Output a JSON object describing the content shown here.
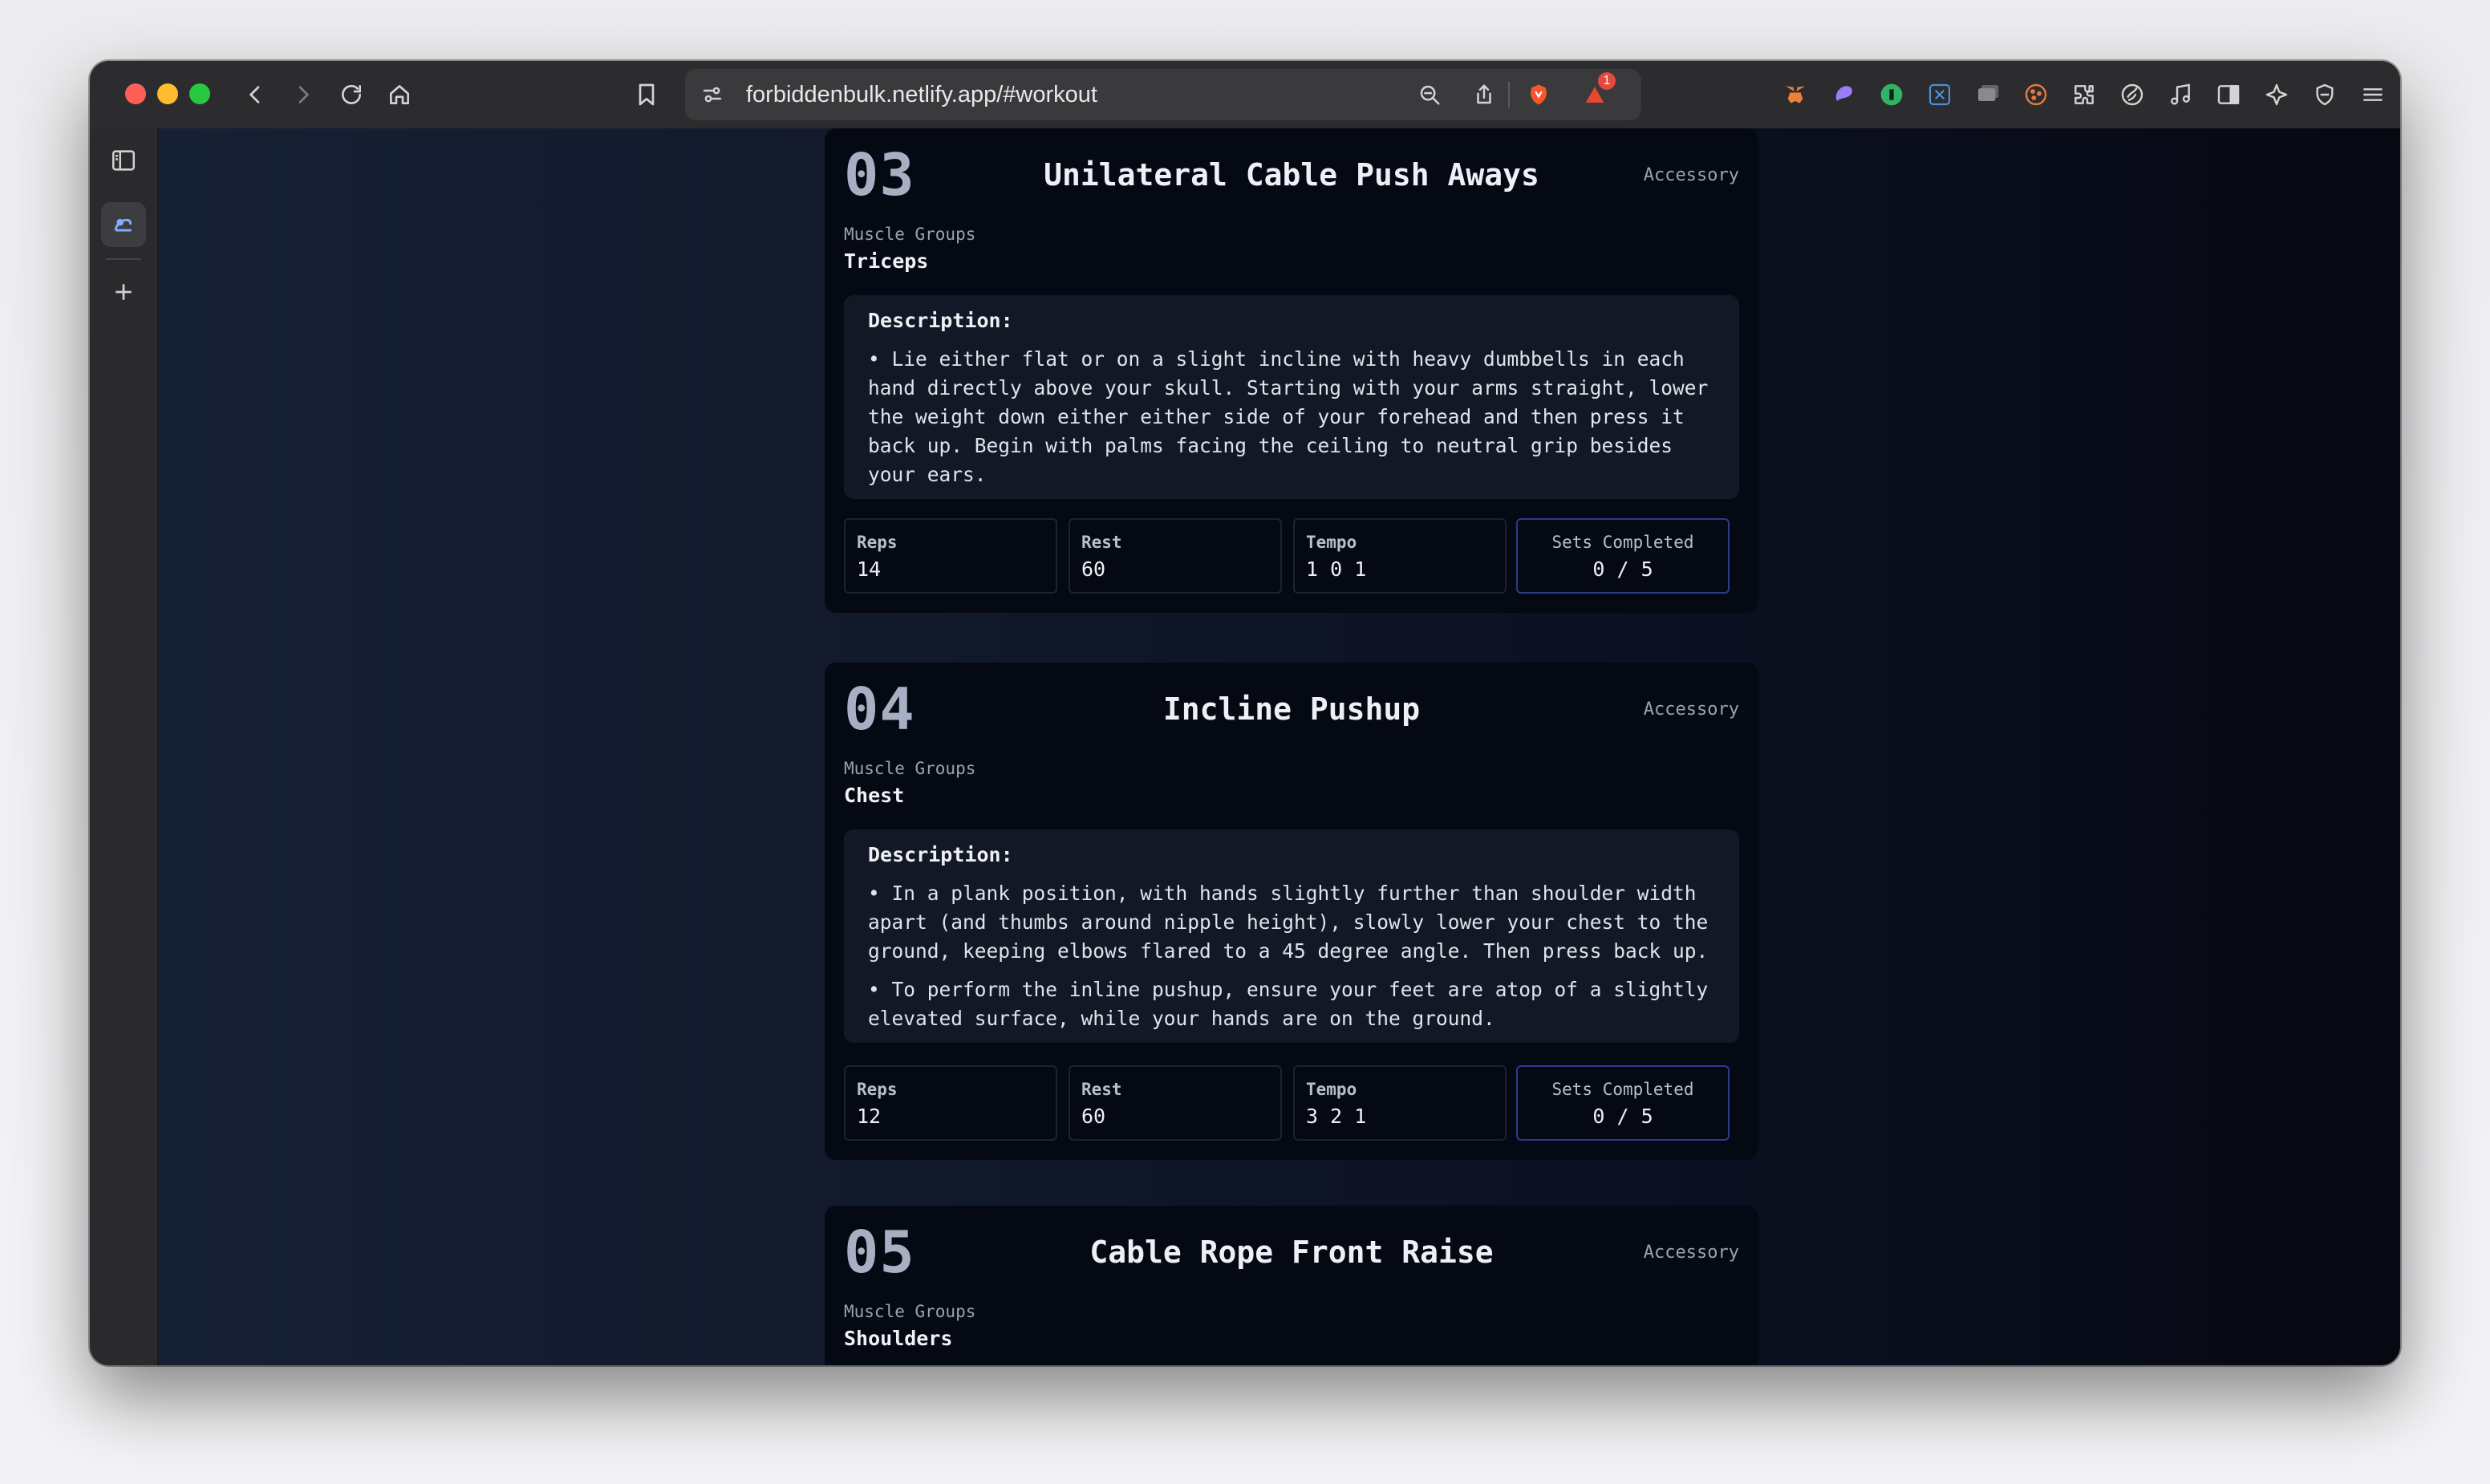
{
  "browser": {
    "url": "forbiddenbulk.netlify.app/#workout",
    "notification_count": "1"
  },
  "exercises": [
    {
      "number": "03",
      "title": "Unilateral Cable Push Aways",
      "category": "Accessory",
      "muscle_label": "Muscle Groups",
      "muscle_value": "Triceps",
      "desc_heading": "Description:",
      "bullets": [
        "• Lie either flat or on a slight incline with heavy dumbbells in each hand directly above your skull. Starting with your arms straight, lower the weight down either either side of your forehead and then press it back up. Begin with palms facing the ceiling to neutral grip besides your ears."
      ],
      "stats": {
        "reps_label": "Reps",
        "reps": "14",
        "rest_label": "Rest",
        "rest": "60",
        "tempo_label": "Tempo",
        "tempo": "1 0 1",
        "sets_label": "Sets Completed",
        "sets": "0 / 5"
      }
    },
    {
      "number": "04",
      "title": "Incline Pushup",
      "category": "Accessory",
      "muscle_label": "Muscle Groups",
      "muscle_value": "Chest",
      "desc_heading": "Description:",
      "bullets": [
        "• In a plank position, with hands slightly further than shoulder width apart (and thumbs around nipple height), slowly lower your chest to the ground, keeping elbows flared to a 45 degree angle. Then press back up.",
        "• To perform the inline pushup, ensure your feet are atop of a slightly elevated surface, while your hands are on the ground."
      ],
      "stats": {
        "reps_label": "Reps",
        "reps": "12",
        "rest_label": "Rest",
        "rest": "60",
        "tempo_label": "Tempo",
        "tempo": "3 2 1",
        "sets_label": "Sets Completed",
        "sets": "0 / 5"
      }
    },
    {
      "number": "05",
      "title": "Cable Rope Front Raise",
      "category": "Accessory",
      "muscle_label": "Muscle Groups",
      "muscle_value": "Shoulders"
    }
  ]
}
